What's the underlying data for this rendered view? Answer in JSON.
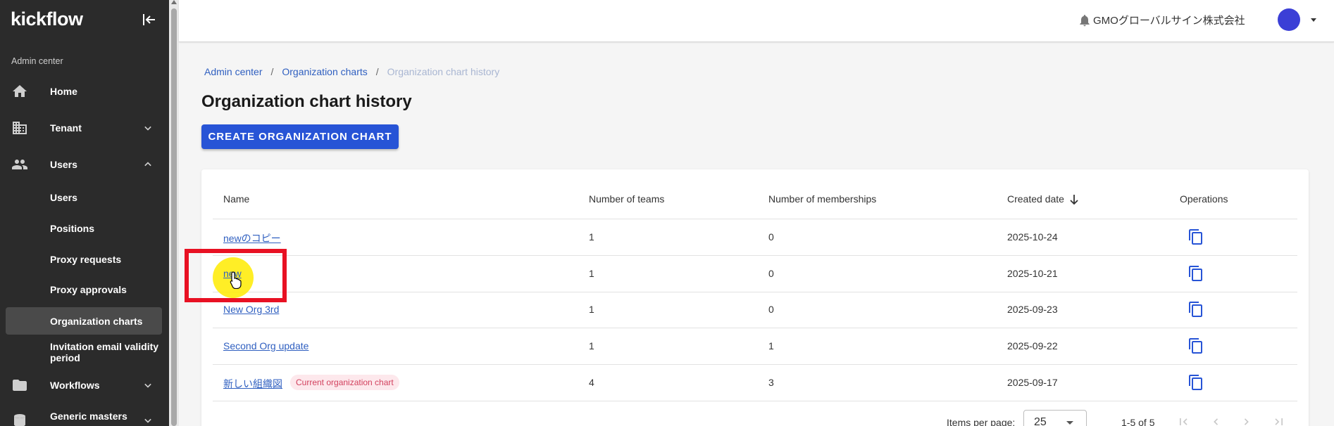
{
  "app": {
    "logo": "kickflow"
  },
  "sidebar": {
    "section_label": "Admin center",
    "items": [
      {
        "label": "Home",
        "icon": "home-icon"
      },
      {
        "label": "Tenant",
        "icon": "building-icon"
      },
      {
        "label": "Users",
        "icon": "people-icon"
      },
      {
        "label": "Workflows",
        "icon": "folder-icon"
      },
      {
        "label": "Generic masters",
        "icon": "database-icon"
      }
    ],
    "sub_items": [
      {
        "label": "Users"
      },
      {
        "label": "Positions"
      },
      {
        "label": "Proxy requests"
      },
      {
        "label": "Proxy approvals"
      },
      {
        "label": "Organization charts"
      },
      {
        "label": "Invitation email validity period"
      }
    ]
  },
  "header": {
    "org_name": "GMOグローバルサイン株式会社"
  },
  "breadcrumb": [
    "Admin center",
    "Organization charts",
    "Organization chart history"
  ],
  "page": {
    "title": "Organization chart history",
    "create_button": "CREATE ORGANIZATION CHART"
  },
  "table": {
    "columns": [
      "Name",
      "Number of teams",
      "Number of memberships",
      "Created date",
      "Operations"
    ],
    "rows": [
      {
        "name": "newのコピー",
        "teams": "1",
        "memberships": "0",
        "created": "2025-10-24"
      },
      {
        "name": "new",
        "teams": "1",
        "memberships": "0",
        "created": "2025-10-21"
      },
      {
        "name": "New Org 3rd",
        "teams": "1",
        "memberships": "0",
        "created": "2025-09-23"
      },
      {
        "name": "Second Org update",
        "teams": "1",
        "memberships": "1",
        "created": "2025-09-22"
      },
      {
        "name": "新しい組織図",
        "badge": "Current organization chart",
        "teams": "4",
        "memberships": "3",
        "created": "2025-09-17"
      }
    ],
    "sort": {
      "column": "Created date",
      "direction": "descending"
    }
  },
  "pagination": {
    "items_per_page_label": "Items per page:",
    "items_per_page": "25",
    "range": "1-5 of 5"
  },
  "colors": {
    "primary": "#2754d6",
    "sidebar": "#2b2b2b",
    "link": "#2f5fc0",
    "highlight": "#e81123"
  }
}
